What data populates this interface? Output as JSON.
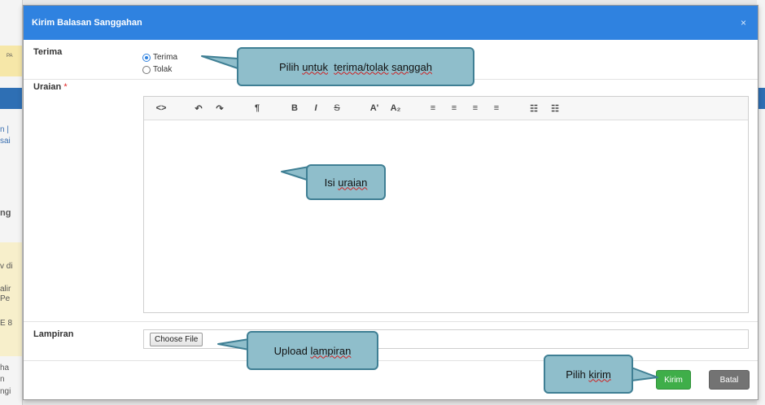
{
  "background": {
    "fragments": [
      "n |",
      "sai",
      "ng",
      "v di",
      "alir",
      "Pe",
      "E 8",
      "ha",
      "n",
      "ngi"
    ],
    "tiny": "PA"
  },
  "modal": {
    "title": "Kirim Balasan Sanggahan",
    "close": "×",
    "terima_label": "Terima",
    "radio_options": [
      {
        "label": "Terima",
        "checked": true
      },
      {
        "label": "Tolak",
        "checked": false
      }
    ],
    "uraian_label": "Uraian",
    "required_mark": "*",
    "toolbar": {
      "code": "<>",
      "undo": "↶",
      "redo": "↷",
      "paragraph": "¶",
      "bold": "B",
      "italic": "I",
      "strike": "S",
      "superscript": "A'",
      "subscript": "A₂",
      "align_left": "≡",
      "align_center": "≡",
      "align_right": "≡",
      "justify": "≡",
      "bullet_list": "☷",
      "numbered_list": "☷"
    },
    "editor_value": "",
    "lampiran_label": "Lampiran",
    "choose_file": "Choose File",
    "kirim": "Kirim",
    "batal": "Batal"
  },
  "callouts": {
    "terima": [
      "Pilih ",
      "untuk",
      "  ",
      "terima/tolak",
      " ",
      "sanggah"
    ],
    "uraian": [
      "Isi ",
      "uraian"
    ],
    "lampiran": [
      "Upload ",
      "lampiran"
    ],
    "kirim": [
      "Pilih ",
      "kirim"
    ]
  },
  "colors": {
    "header": "#2f82e0",
    "kirim": "#3fae49",
    "batal": "#737373",
    "callout": "#8fbecb"
  }
}
